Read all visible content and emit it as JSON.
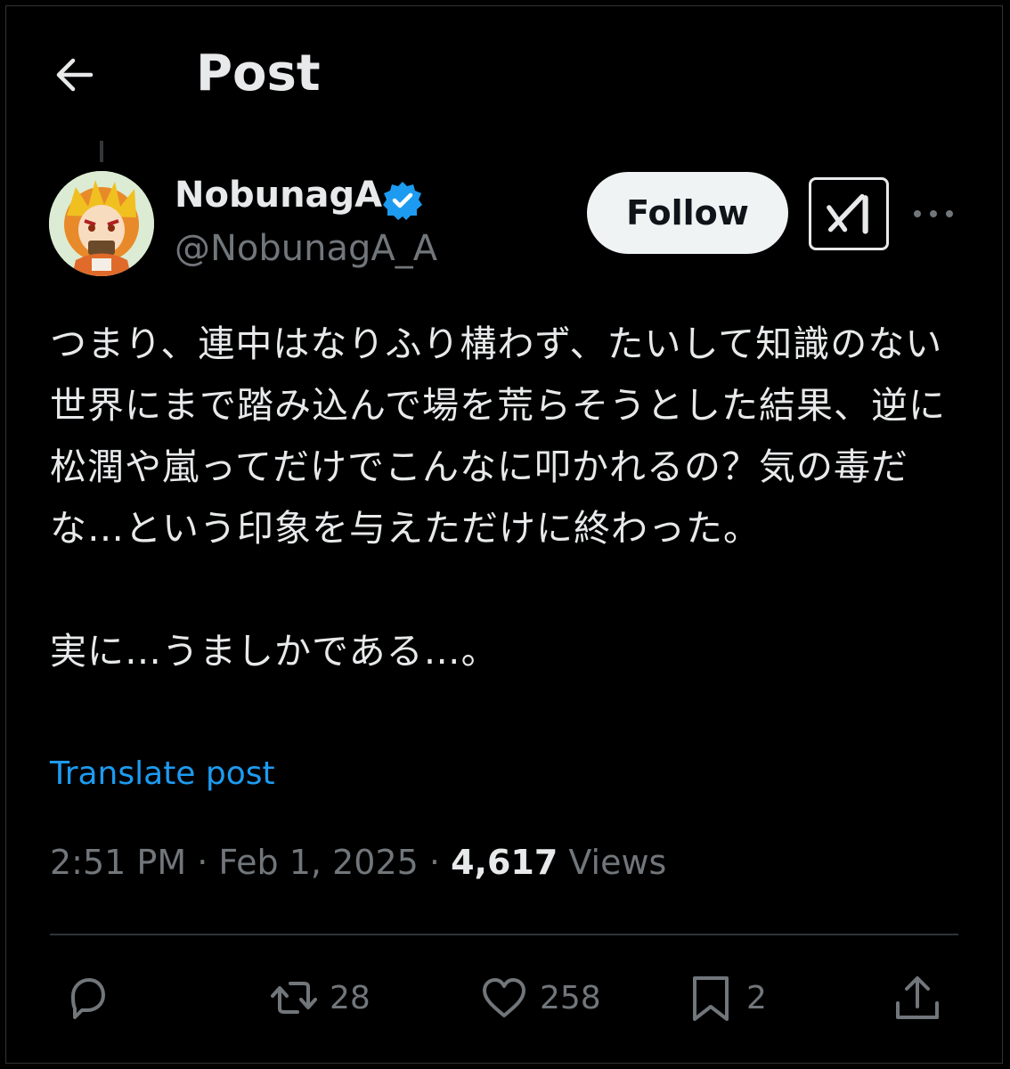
{
  "header": {
    "title": "Post"
  },
  "author": {
    "name": "NobunagA",
    "handle": "@NobunagA_A",
    "verified": true
  },
  "buttons": {
    "follow_label": "Follow"
  },
  "post": {
    "text": "つまり、連中はなりふり構わず、たいして知識のない世界にまで踏み込んで場を荒らそうとした結果、逆に松潤や嵐ってだけでこんなに叩かれるの？気の毒だな…という印象を与えただけに終わった。\n\n実に…うましかである…。",
    "translate_label": "Translate post",
    "time": "2:51 PM",
    "date": "Feb 1, 2025",
    "views_count": "4,617",
    "views_label": "Views"
  },
  "actions": {
    "retweets": "28",
    "likes": "258",
    "bookmarks": "2"
  },
  "colors": {
    "accent": "#1d9bf0",
    "muted": "#71767b",
    "text": "#e7e9ea",
    "background": "#000000"
  }
}
